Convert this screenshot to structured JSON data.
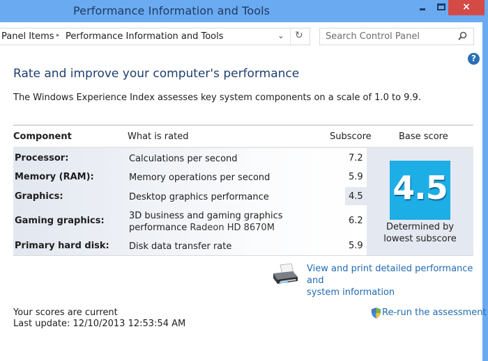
{
  "window": {
    "title": "Performance Information and Tools",
    "controls": {
      "minimize": "minimize",
      "maximize": "maximize",
      "close": "×"
    }
  },
  "address_bar": {
    "breadcrumbs": [
      "Panel Items",
      "Performance Information and Tools"
    ],
    "separator": "▸",
    "dropdown_icon": "⌄",
    "refresh_icon": "↻"
  },
  "search": {
    "placeholder": "Search Control Panel"
  },
  "help": {
    "icon": "?"
  },
  "main": {
    "heading": "Rate and improve your computer's performance",
    "description": "The Windows Experience Index assesses key system components on a scale of 1.0 to 9.9."
  },
  "table": {
    "headers": {
      "component": "Component",
      "what": "What is rated",
      "subscore": "Subscore",
      "base": "Base score"
    },
    "rows": [
      {
        "component": "Processor:",
        "what": "Calculations per second",
        "what_extra": "",
        "subscore": "7.2"
      },
      {
        "component": "Memory (RAM):",
        "what": "Memory operations per second",
        "what_extra": "",
        "subscore": "5.9"
      },
      {
        "component": "Graphics:",
        "what": "Desktop graphics performance",
        "what_extra": "",
        "subscore": "4.5",
        "lowest": true
      },
      {
        "component": "Gaming graphics:",
        "what": "3D business and gaming graphics",
        "what_line2": "performance",
        "what_extra": "Radeon HD 8670M",
        "subscore": "6.2"
      },
      {
        "component": "Primary hard disk:",
        "what": "Disk data transfer rate",
        "what_extra": "",
        "subscore": "5.9"
      }
    ],
    "base_score": "4.5",
    "base_caption_line1": "Determined by",
    "base_caption_line2": "lowest subscore",
    "base_tile_color": "#1daee6"
  },
  "links": {
    "print_line1": "View and print detailed performance and",
    "print_line2": "system information",
    "rerun": "Re-run the assessment"
  },
  "status": {
    "scores": "Your scores are current",
    "last_update": "Last update: 12/10/2013 12:53:54 AM"
  },
  "colors": {
    "titlebar": "#6aaaf0",
    "close": "#d44a45",
    "link": "#1f6ab3",
    "heading": "#1e3f6e"
  }
}
